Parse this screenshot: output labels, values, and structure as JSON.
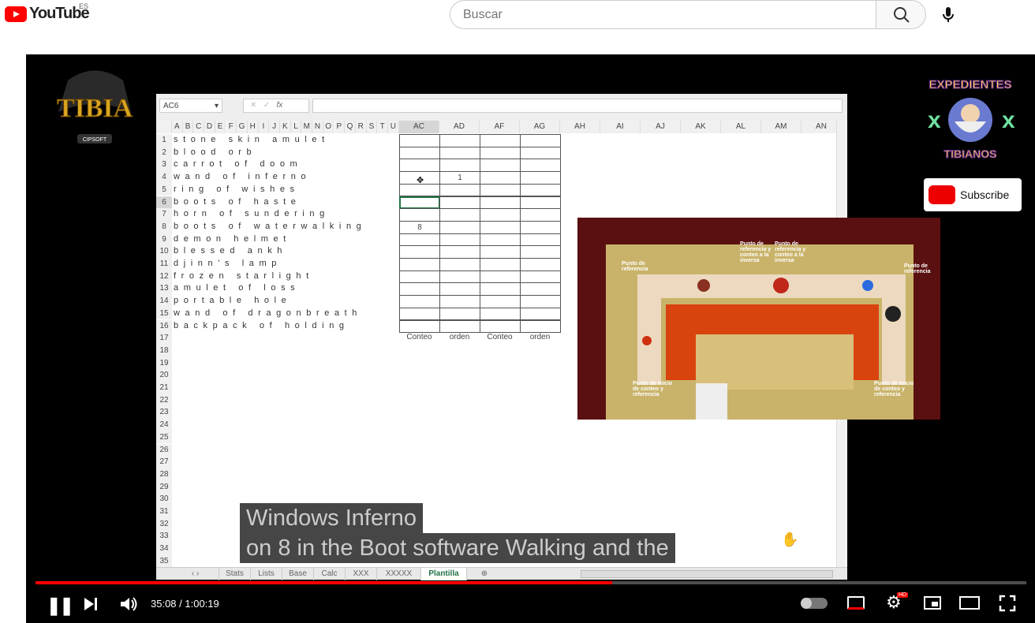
{
  "header": {
    "logo": "YouTube",
    "region": "ES",
    "search_placeholder": "Buscar",
    "search_icon": "search-icon",
    "mic_icon": "mic-icon"
  },
  "excel": {
    "name_box": "AC6",
    "columns_narrow": [
      "A",
      "B",
      "C",
      "D",
      "E",
      "F",
      "G",
      "H",
      "I",
      "J",
      "K",
      "L",
      "M",
      "N",
      "O",
      "P",
      "Q",
      "R",
      "S",
      "T",
      "U"
    ],
    "columns_wide": [
      "AC",
      "AD",
      "AF",
      "AG",
      "AH",
      "AI",
      "AJ",
      "AK",
      "AL",
      "AM",
      "AN"
    ],
    "rows": [
      "1",
      "2",
      "3",
      "4",
      "5",
      "6",
      "7",
      "8",
      "9",
      "10",
      "11",
      "12",
      "13",
      "14",
      "15",
      "16",
      "17",
      "18",
      "19",
      "20",
      "21",
      "22",
      "23",
      "24",
      "25",
      "26",
      "27",
      "28",
      "29",
      "30",
      "31",
      "32",
      "33",
      "34",
      "35"
    ],
    "items": [
      "stone skin amulet",
      "blood orb",
      "carrot of doom",
      "wand of inferno",
      "ring of wishes",
      "boots of haste",
      "horn of sundering",
      "boots of waterwalking",
      "demon helmet",
      "blessed ankh",
      "djinn's lamp",
      "frozen starlight",
      "amulet of loss",
      "portable hole",
      "wand of dragonbreath",
      "backpack of holding"
    ],
    "cell_values": {
      "AD4": "1",
      "AC8": "8"
    },
    "footer_labels": [
      "Conteo",
      "orden",
      "Conteo",
      "orden"
    ],
    "sheet_tabs": [
      "Stats",
      "Lists",
      "Base",
      "Calc",
      "XXX",
      "XXXXX",
      "Plantilla"
    ],
    "active_tab": "Plantilla"
  },
  "overlay": {
    "logo_text": "TIBIA",
    "logo_sub": "CIPSOFT",
    "channel_logo": "EXPEDIENTES TIBIANOS",
    "subscribe": "Subscribe",
    "game_labels": [
      "Punto de referencia y conteo a la inversa",
      "Punto de referencia y conteo a la inversa",
      "Punto de referencia",
      "Punto de referencia",
      "Punto de Inicio de conteo y referencia",
      "Punto de Inicio de conteo y referencia"
    ]
  },
  "subtitles": [
    "Windows Inferno",
    "on 8  in the Boot software Walking and the"
  ],
  "player": {
    "time": "35:08 / 1:00:19",
    "progress_percent": 58.2,
    "accent": "#ff0000",
    "settings_badge": "HD"
  }
}
